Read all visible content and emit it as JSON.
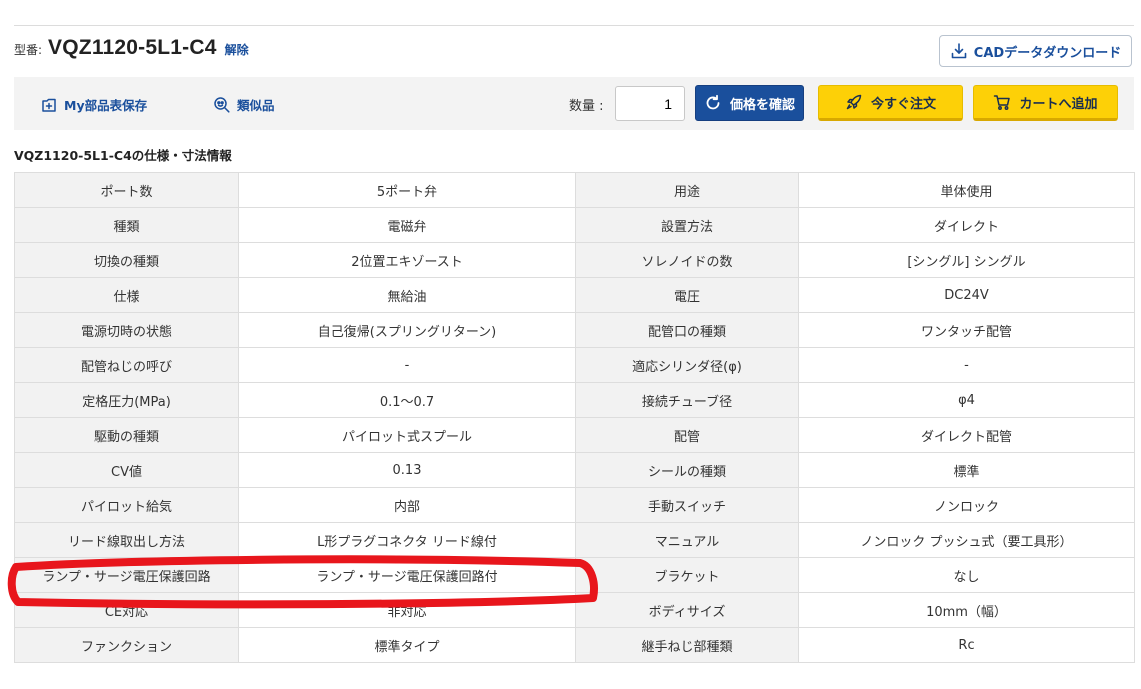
{
  "header": {
    "part_label": "型番:",
    "part_number": "VQZ1120-5L1-C4",
    "release_link": "解除",
    "cad_button": "CADデータダウンロード"
  },
  "action_bar": {
    "bom_save": "My部品表保存",
    "similar": "類似品",
    "quantity_label": "数量 :",
    "quantity_value": "1",
    "price_button": "価格を確認",
    "order_button": "今すぐ注文",
    "cart_button": "カートへ追加"
  },
  "spec": {
    "title": "VQZ1120-5L1-C4の仕様・寸法情報",
    "rows": [
      {
        "k1": "ポート数",
        "v1": "5ポート弁",
        "k2": "用途",
        "v2": "単体使用"
      },
      {
        "k1": "種類",
        "v1": "電磁弁",
        "k2": "設置方法",
        "v2": "ダイレクト"
      },
      {
        "k1": "切換の種類",
        "v1": "2位置エキゾースト",
        "k2": "ソレノイドの数",
        "v2": "[シングル] シングル"
      },
      {
        "k1": "仕様",
        "v1": "無給油",
        "k2": "電圧",
        "v2": "DC24V"
      },
      {
        "k1": "電源切時の状態",
        "v1": "自己復帰(スプリングリターン)",
        "k2": "配管口の種類",
        "v2": "ワンタッチ配管"
      },
      {
        "k1": "配管ねじの呼び",
        "v1": "-",
        "k2": "適応シリンダ径(φ)",
        "v2": "-"
      },
      {
        "k1": "定格圧力(MPa)",
        "v1": "0.1～0.7",
        "k2": "接続チューブ径",
        "v2": "φ4"
      },
      {
        "k1": "駆動の種類",
        "v1": "パイロット式スプール",
        "k2": "配管",
        "v2": "ダイレクト配管"
      },
      {
        "k1": "CV値",
        "v1": "0.13",
        "k2": "シールの種類",
        "v2": "標準"
      },
      {
        "k1": "パイロット給気",
        "v1": "内部",
        "k2": "手動スイッチ",
        "v2": "ノンロック"
      },
      {
        "k1": "リード線取出し方法",
        "v1": "L形プラグコネクタ リード線付",
        "k2": "マニュアル",
        "v2": "ノンロック プッシュ式（要工具形）"
      },
      {
        "k1": "ランプ・サージ電圧保護回路",
        "v1": "ランプ・サージ電圧保護回路付",
        "k2": "ブラケット",
        "v2": "なし"
      },
      {
        "k1": "CE対応",
        "v1": "非対応",
        "k2": "ボディサイズ",
        "v2": "10mm（幅）"
      },
      {
        "k1": "ファンクション",
        "v1": "標準タイプ",
        "k2": "継手ねじ部種類",
        "v2": "Rc"
      }
    ]
  },
  "colors": {
    "accent_blue": "#1a4f9c",
    "accent_yellow": "#fdd007",
    "highlight_red": "#e8161c"
  },
  "icons": {
    "cad": "download-icon",
    "bom": "add-list-icon",
    "similar": "similar-search-icon",
    "price": "refresh-icon",
    "order": "rocket-icon",
    "cart": "cart-icon"
  }
}
